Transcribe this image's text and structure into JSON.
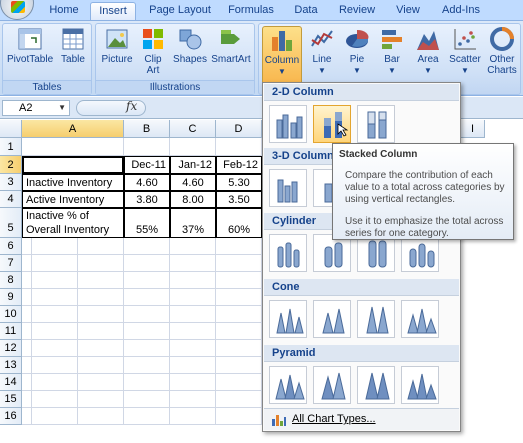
{
  "ribbon_tabs": [
    "Home",
    "Insert",
    "Page Layout",
    "Formulas",
    "Data",
    "Review",
    "View",
    "Add-Ins"
  ],
  "groups": {
    "tables": {
      "label": "Tables",
      "buttons": [
        "PivotTable",
        "Table"
      ]
    },
    "illustrations": {
      "label": "Illustrations",
      "buttons": [
        "Picture",
        "Clip Art",
        "Shapes",
        "SmartArt"
      ]
    },
    "charts": {
      "buttons": [
        "Column",
        "Line",
        "Pie",
        "Bar",
        "Area",
        "Scatter",
        "Other Charts"
      ]
    }
  },
  "namebox": "A2",
  "fx": "fx",
  "columns": [
    "A",
    "B",
    "C",
    "D",
    "I"
  ],
  "rows": [
    "1",
    "2",
    "3",
    "4",
    "5",
    "6",
    "7",
    "8",
    "9",
    "10",
    "11",
    "12",
    "13",
    "14",
    "15",
    "16"
  ],
  "table": {
    "headers": [
      "Dec-11",
      "Jan-12",
      "Feb-12"
    ],
    "rows": [
      {
        "label": "Inactive Inventory",
        "values": [
          "4.60",
          "4.60",
          "5.30"
        ]
      },
      {
        "label": "Active Inventory",
        "values": [
          "3.80",
          "8.00",
          "3.50"
        ]
      },
      {
        "label_line1": "Inactive % of",
        "label_line2": "Overall Inventory",
        "values": [
          "55%",
          "37%",
          "60%"
        ]
      }
    ]
  },
  "gallery": {
    "sections": [
      "2-D Column",
      "3-D Column",
      "Cylinder",
      "Cone",
      "Pyramid"
    ],
    "footer": "All Chart Types..."
  },
  "tooltip": {
    "title": "Stacked Column",
    "p1": "Compare the contribution of each value to a total across categories by using vertical rectangles.",
    "p2": "Use it to emphasize the total across series for one category."
  },
  "colors": {
    "ribbon": "#dbe8f9",
    "accent": "#15428b",
    "highlight": "#f8b44a"
  }
}
